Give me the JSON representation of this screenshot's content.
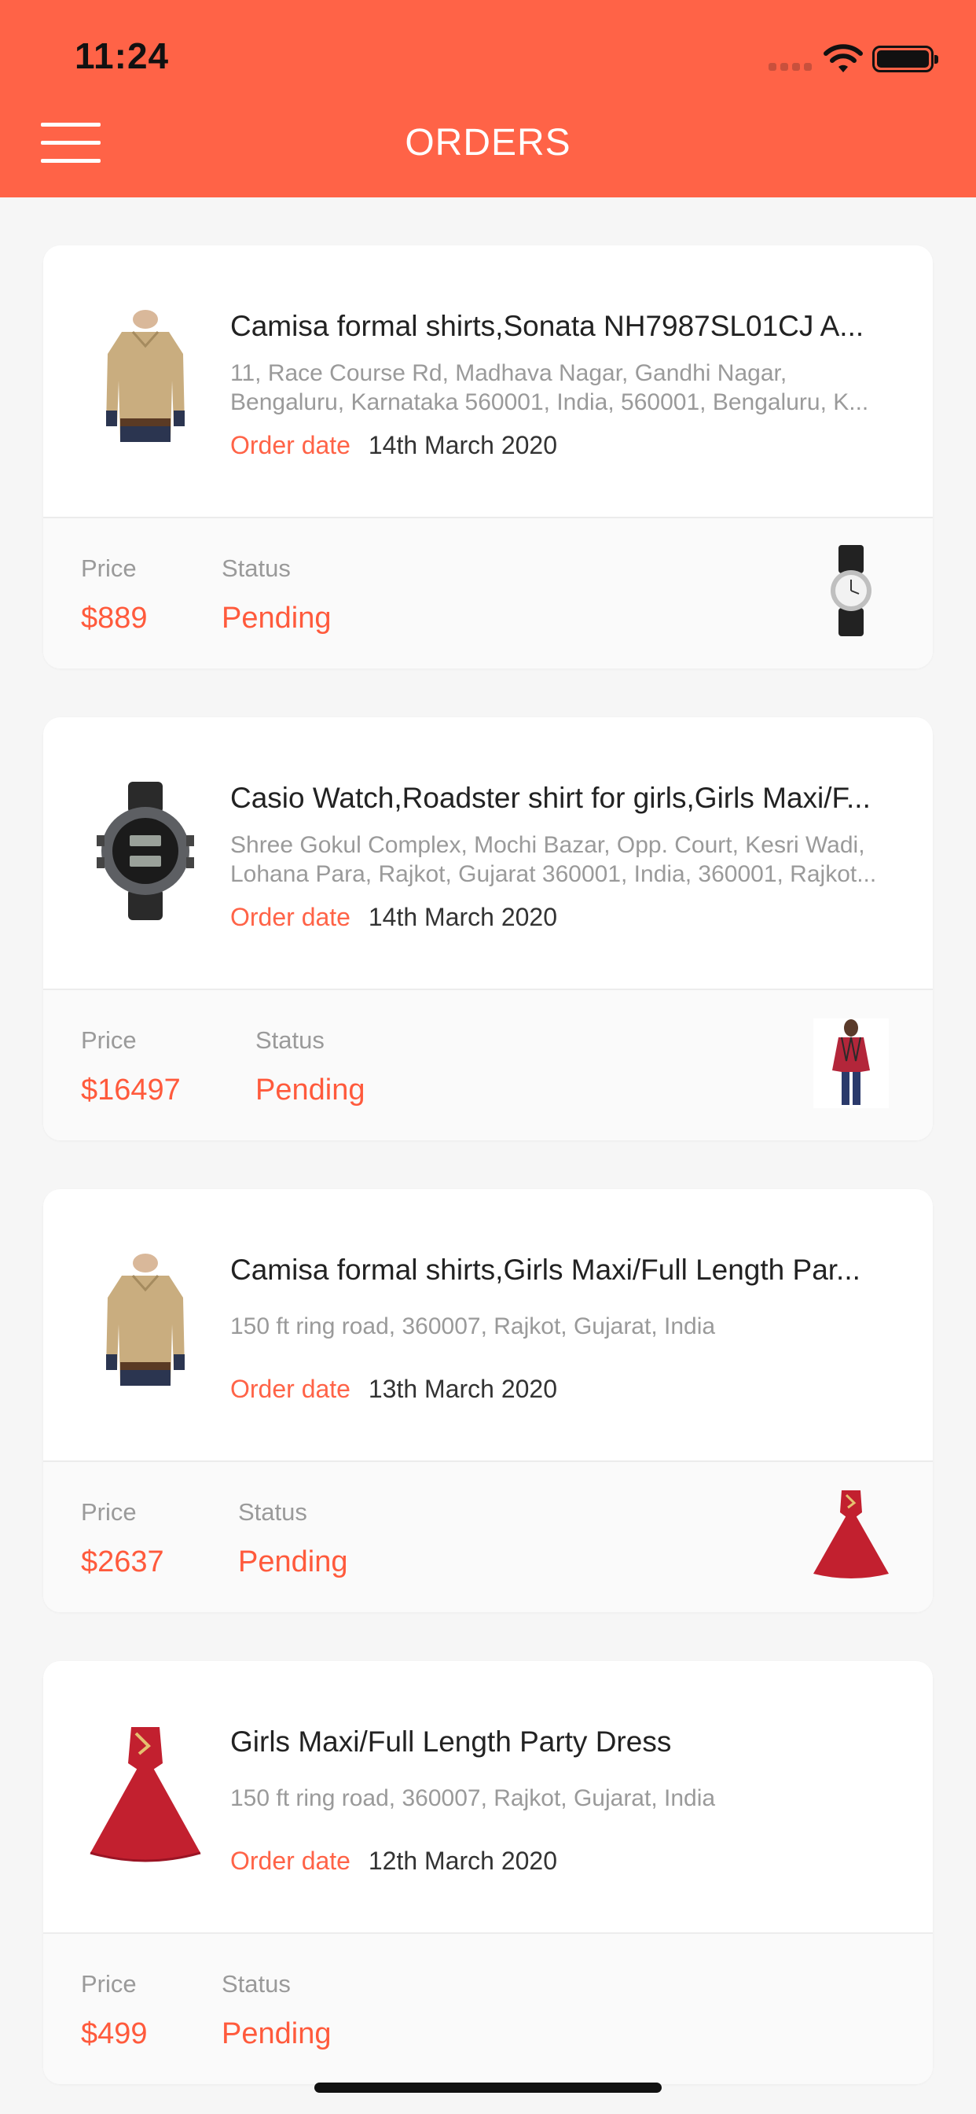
{
  "status_bar": {
    "time": "11:24"
  },
  "header": {
    "title": "ORDERS"
  },
  "labels": {
    "order_date": "Order date",
    "price": "Price",
    "status": "Status"
  },
  "orders": [
    {
      "title": "Camisa formal shirts,Sonata NH7987SL01CJ A...",
      "address_line1": "11, Race Course Rd, Madhava Nagar, Gandhi Nagar,",
      "address_line2": "Bengaluru, Karnataka 560001, India, 560001, Bengaluru, K...",
      "date": "14th March 2020",
      "price": "$889",
      "status": "Pending",
      "main_icon": "shirt-icon",
      "thumb_icon": "watch-icon"
    },
    {
      "title": "Casio Watch,Roadster shirt for girls,Girls Maxi/F...",
      "address_line1": "Shree Gokul Complex, Mochi Bazar, Opp. Court, Kesri Wadi,",
      "address_line2": "Lohana Para, Rajkot, Gujarat 360001, India, 360001, Rajkot...",
      "date": "14th March 2020",
      "price": "$16497",
      "status": "Pending",
      "main_icon": "watch-icon",
      "thumb_icon": "girl-shirt-icon"
    },
    {
      "title": "Camisa formal shirts,Girls Maxi/Full Length Par...",
      "address_line1": "150 ft ring road, 360007, Rajkot, Gujarat, India",
      "address_line2": "",
      "date": "13th March 2020",
      "price": "$2637",
      "status": "Pending",
      "main_icon": "shirt-icon",
      "thumb_icon": "dress-icon"
    },
    {
      "title": "Girls Maxi/Full Length Party Dress",
      "address_line1": "150 ft ring road, 360007, Rajkot, Gujarat, India",
      "address_line2": "",
      "date": "12th March 2020",
      "price": "$499",
      "status": "Pending",
      "main_icon": "dress-icon",
      "thumb_icon": ""
    }
  ],
  "colors": {
    "accent": "#ff6347",
    "status_pending": "#ff5a3c",
    "background": "#f6f6f6"
  }
}
